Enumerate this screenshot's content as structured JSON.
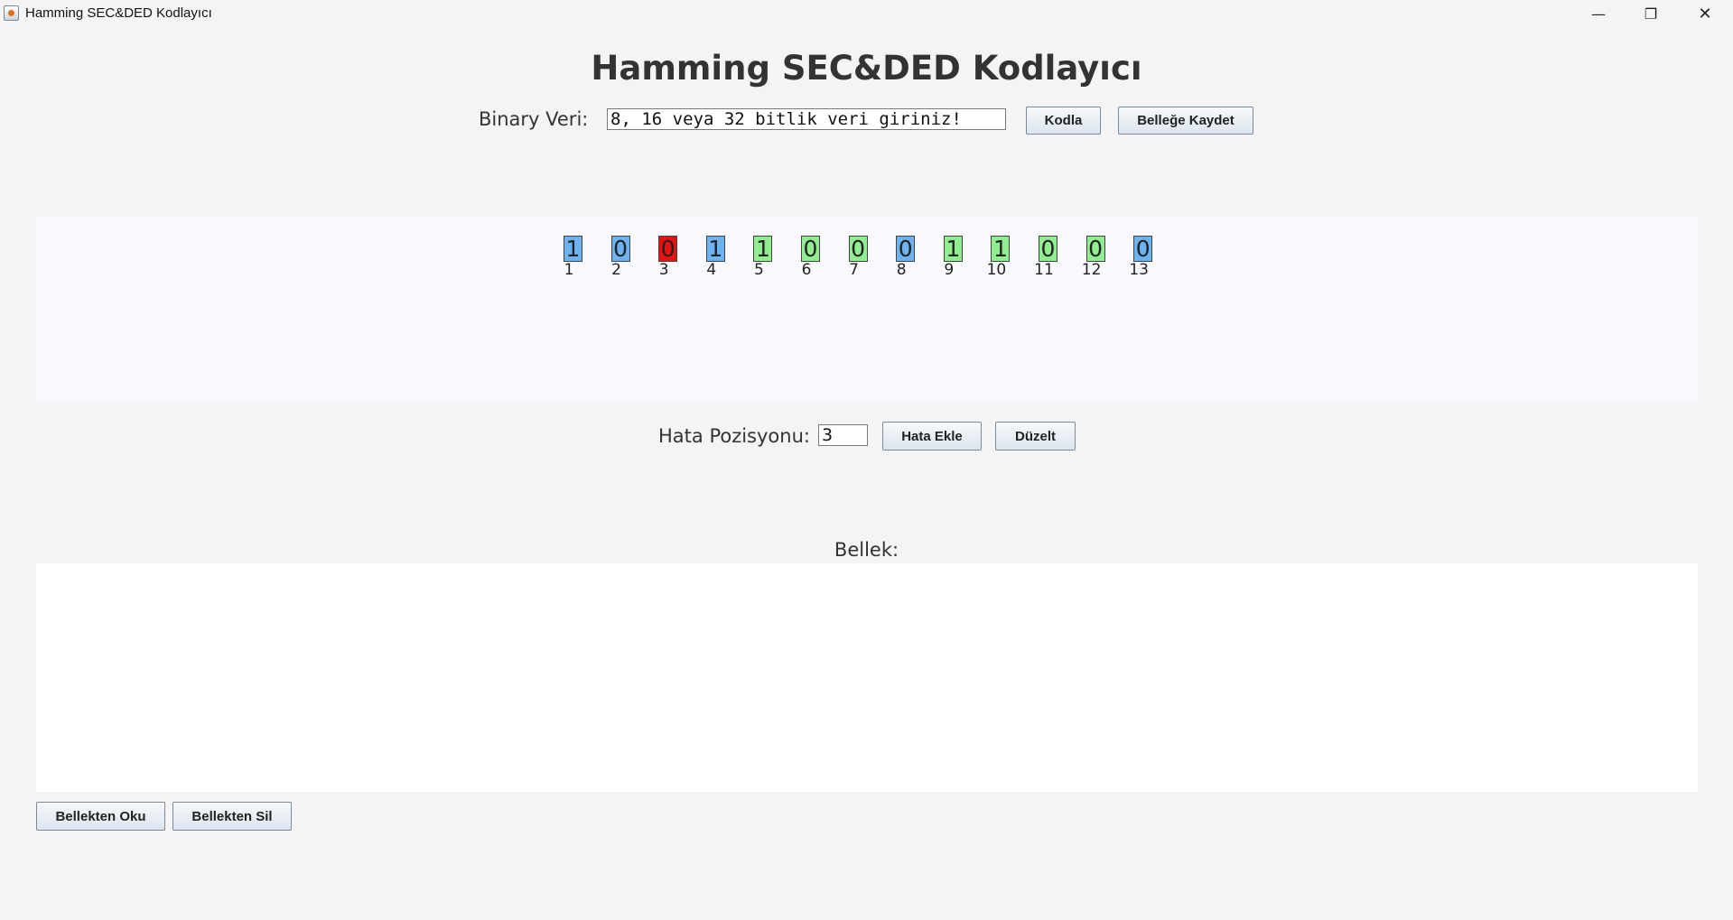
{
  "window": {
    "title": "Hamming SEC&DED Kodlayıcı",
    "minimize_icon": "minimize-icon",
    "maximize_icon": "restore-icon",
    "close_icon": "close-icon"
  },
  "header": {
    "title": "Hamming SEC&DED Kodlayıcı"
  },
  "input_row": {
    "label": "Binary Veri:",
    "input_value": "8, 16 veya 32 bitlik veri giriniz!",
    "encode_button": "Kodla",
    "save_button": "Belleğe Kaydet"
  },
  "bits": [
    {
      "value": "1",
      "index": "1",
      "color": "#6db3f2"
    },
    {
      "value": "0",
      "index": "2",
      "color": "#6db3f2"
    },
    {
      "value": "0",
      "index": "3",
      "color": "#e8110f"
    },
    {
      "value": "1",
      "index": "4",
      "color": "#6db3f2"
    },
    {
      "value": "1",
      "index": "5",
      "color": "#90ee90"
    },
    {
      "value": "0",
      "index": "6",
      "color": "#90ee90"
    },
    {
      "value": "0",
      "index": "7",
      "color": "#90ee90"
    },
    {
      "value": "0",
      "index": "8",
      "color": "#6db3f2"
    },
    {
      "value": "1",
      "index": "9",
      "color": "#90ee90"
    },
    {
      "value": "1",
      "index": "10",
      "color": "#90ee90"
    },
    {
      "value": "0",
      "index": "11",
      "color": "#90ee90"
    },
    {
      "value": "0",
      "index": "12",
      "color": "#90ee90"
    },
    {
      "value": "0",
      "index": "13",
      "color": "#6db3f2"
    }
  ],
  "error_row": {
    "label": "Hata Pozisyonu:",
    "input_value": "3",
    "add_error_button": "Hata Ekle",
    "fix_button": "Düzelt"
  },
  "memory": {
    "label": "Bellek:",
    "read_button": "Bellekten Oku",
    "delete_button": "Bellekten Sil"
  }
}
